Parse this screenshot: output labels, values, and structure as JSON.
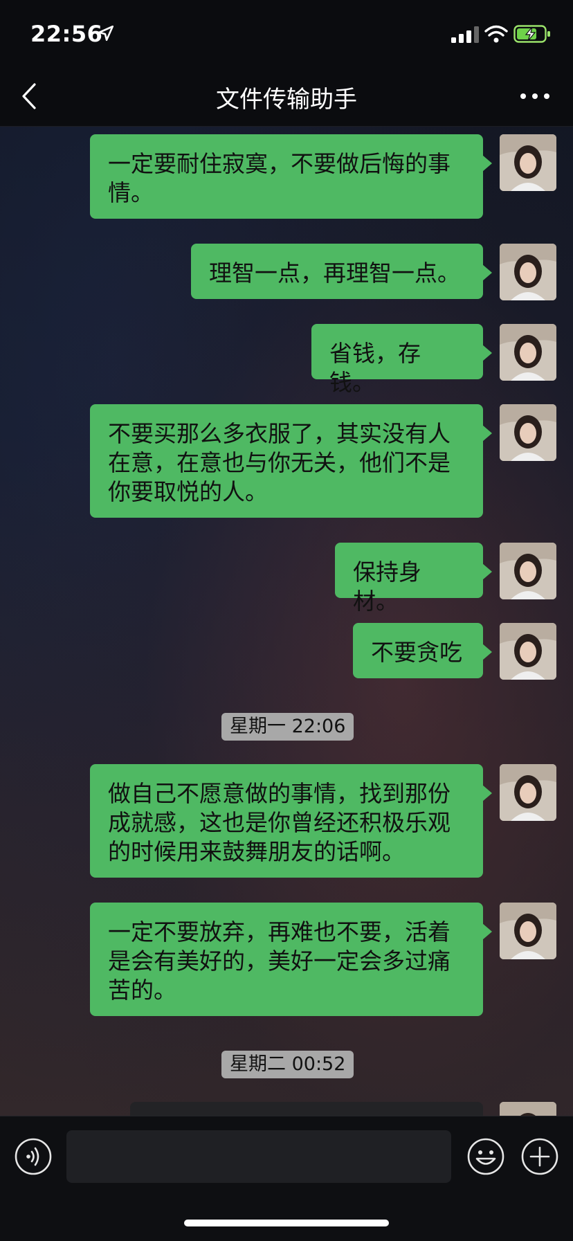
{
  "status_bar": {
    "time": "22:56"
  },
  "header": {
    "title": "文件传输助手"
  },
  "messages": [
    {
      "text": "一定要耐住寂寞，不要做后悔的事情。"
    },
    {
      "text": "理智一点，再理智一点。"
    },
    {
      "text": "省钱，存钱。"
    },
    {
      "text": "不要买那么多衣服了，其实没有人在意，在意也与你无关，他们不是你要取悦的人。"
    },
    {
      "text": "保持身材。"
    },
    {
      "text": "不要贪吃"
    },
    {
      "text": "做自己不愿意做的事情，找到那份成就感，这也是你曾经还积极乐观的时候用来鼓舞朋友的话啊。"
    },
    {
      "text": "一定不要放弃，再难也不要，活着是会有美好的，美好一定会多过痛苦的。"
    }
  ],
  "timestamps": [
    {
      "text": "星期一 22:06"
    },
    {
      "text": "星期二 00:52"
    }
  ],
  "icons": [
    "location-arrow-icon",
    "signal-icon",
    "wifi-icon",
    "battery-charging-icon",
    "back-chevron-icon",
    "more-dots-icon",
    "voice-icon",
    "emoji-icon",
    "plus-icon"
  ],
  "colors": {
    "bubble": "#4fb963",
    "nav": "#0b0c0f",
    "timestamp": "#a8a8a8"
  }
}
